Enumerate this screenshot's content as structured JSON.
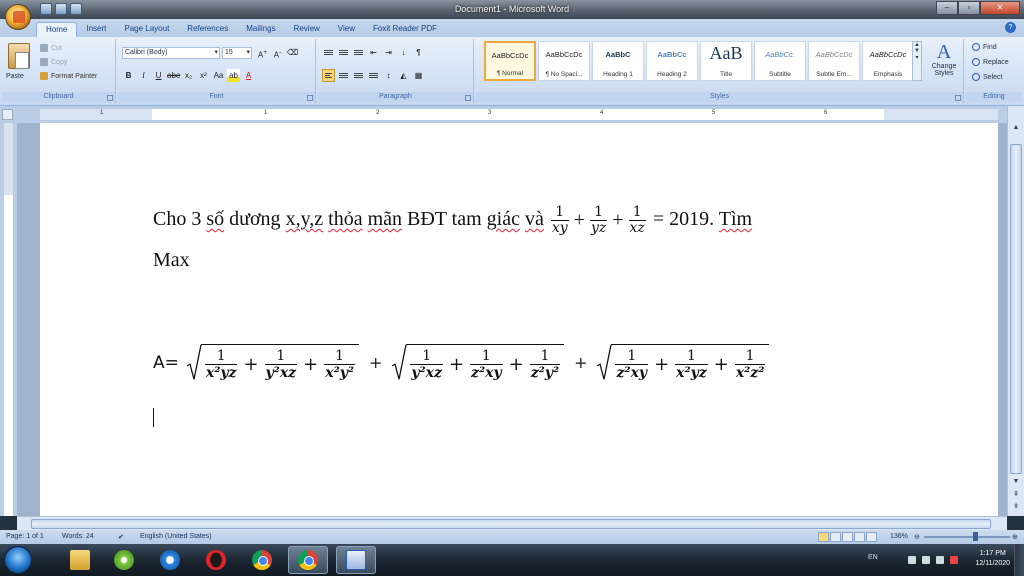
{
  "window": {
    "title": "Document1 - Microsoft Word"
  },
  "ribbon": {
    "tabs": [
      "Home",
      "Insert",
      "Page Layout",
      "References",
      "Mailings",
      "Review",
      "View",
      "Foxit Reader PDF"
    ],
    "clipboard": {
      "paste": "Paste",
      "cut": "Cut",
      "copy": "Copy",
      "format_painter": "Format Painter",
      "label": "Clipboard"
    },
    "font": {
      "name": "Calibri (Body)",
      "size": "15",
      "label": "Font"
    },
    "paragraph": {
      "label": "Paragraph"
    },
    "styles": {
      "label": "Styles",
      "items": [
        {
          "sample": "AaBbCcDc",
          "name": "¶ Normal"
        },
        {
          "sample": "AaBbCcDc",
          "name": "¶ No Spaci..."
        },
        {
          "sample": "AaBbC",
          "name": "Heading 1"
        },
        {
          "sample": "AaBbCc",
          "name": "Heading 2"
        },
        {
          "sample": "AaB",
          "name": "Title"
        },
        {
          "sample": "AaBbCc.",
          "name": "Subtitle"
        },
        {
          "sample": "AaBbCcDc",
          "name": "Subtle Em..."
        },
        {
          "sample": "AaBbCcDc",
          "name": "Emphasis"
        }
      ],
      "change_styles": "Change Styles"
    },
    "editing": {
      "find": "Find",
      "replace": "Replace",
      "select": "Select",
      "label": "Editing"
    }
  },
  "ruler": {
    "numbers": [
      "1",
      "1",
      "2",
      "3",
      "4",
      "5",
      "6"
    ]
  },
  "document": {
    "line1_a": "Cho 3 ",
    "line1_so": "số",
    "line1_b": " dương ",
    "line1_xyz": "x,y,z",
    "line1_c": " ",
    "line1_thoa": "thỏa",
    "line1_d": " ",
    "line1_man": "mãn",
    "line1_e": " BĐT tam ",
    "line1_giac": "giác",
    "line1_f": " ",
    "line1_va": "và",
    "frac1_num": "1",
    "frac1_den": "xy",
    "frac2_num": "1",
    "frac2_den": "yz",
    "frac3_num": "1",
    "frac3_den": "xz",
    "line1_end": "= 2019. ",
    "line1_tim": "Tìm",
    "line2": "Max",
    "formula_label": "A=",
    "plus": "+",
    "root1": [
      {
        "num": "1",
        "den": "x²yz"
      },
      {
        "num": "1",
        "den": "y²xz"
      },
      {
        "num": "1",
        "den": "x²y²"
      }
    ],
    "root2": [
      {
        "num": "1",
        "den": "y²xz"
      },
      {
        "num": "1",
        "den": "z²xy"
      },
      {
        "num": "1",
        "den": "z²y²"
      }
    ],
    "root3": [
      {
        "num": "1",
        "den": "z²xy"
      },
      {
        "num": "1",
        "den": "x²yz"
      },
      {
        "num": "1",
        "den": "x²z²"
      }
    ]
  },
  "statusbar": {
    "page": "Page: 1 of 1",
    "words": "Words: 24",
    "language": "English (United States)",
    "zoom": "136%",
    "zoom_fraction": 0.57
  },
  "taskbar": {
    "language": "EN",
    "time": "1:17 PM",
    "date": "12/11/2020"
  }
}
